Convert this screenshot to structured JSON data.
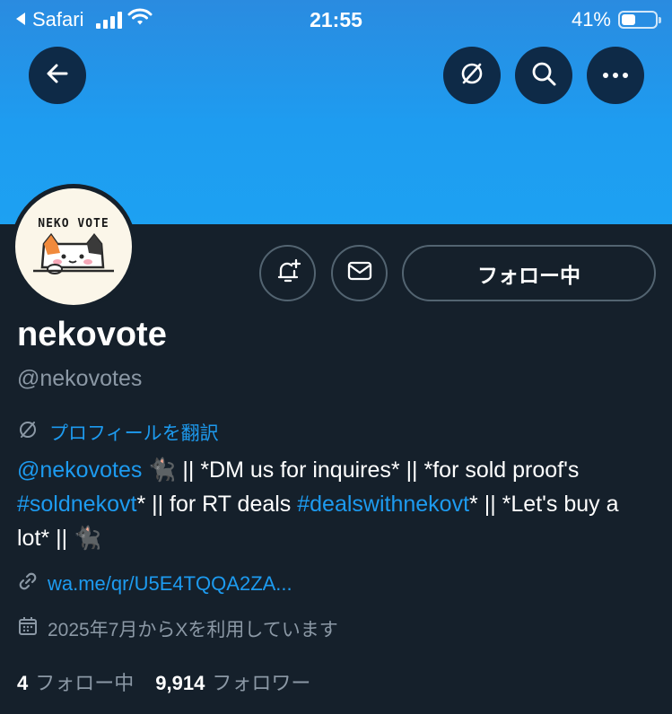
{
  "status_bar": {
    "back_app": "Safari",
    "time": "21:55",
    "battery_percent": "41%",
    "battery_level": 0.41,
    "signal_bars": 4
  },
  "header": {
    "back_icon": "arrow-left-icon",
    "translate_icon": "no-translate-icon",
    "search_icon": "search-icon",
    "more_icon": "more-horizontal-icon"
  },
  "profile": {
    "avatar_text": "NEKO VOTE",
    "display_name": "nekovote",
    "handle": "@nekovotes",
    "follow_button": "フォロー中",
    "translate_label": "プロフィールを翻訳",
    "bio": {
      "mention": "@nekovotes",
      "emoji": "🐈‍⬛",
      "text1": " || *DM us for inquires* || *for sold proof's ",
      "hashtag1": "#soldnekovt",
      "text2": "* || for RT deals ",
      "hashtag2": "#dealswithnekovt",
      "text3": "* || *Let's buy a lot* || "
    },
    "url": "wa.me/qr/U5E4TQQA2ZA...",
    "joined": "2025年7月からXを利用しています",
    "following_count": "4",
    "following_label": "フォロー中",
    "followers_count": "9,914",
    "followers_label": "フォロワー"
  },
  "colors": {
    "background": "#15202b",
    "banner": "#1da1f2",
    "accent": "#1d9bf0",
    "secondary_text": "#8b98a5"
  }
}
